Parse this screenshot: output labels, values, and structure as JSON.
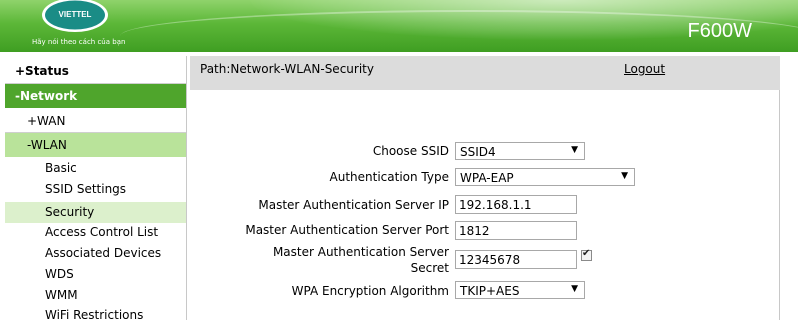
{
  "header": {
    "logo_text": "VIETTEL",
    "slogan": "Hãy nói theo cách của bạn",
    "model": "F600W",
    "brand_colors": {
      "green": "#4fa52c",
      "light_green": "#b9e39a",
      "active_sub": "#dcf0cc"
    }
  },
  "sidebar": {
    "status": "+Status",
    "network": "-Network",
    "wan": "+WAN",
    "wlan": "-WLAN",
    "wlan_items": [
      "Basic",
      "SSID Settings",
      "Security",
      "Access Control List",
      "Associated Devices",
      "WDS",
      "WMM",
      "WiFi Restrictions"
    ],
    "active_item": "Security"
  },
  "pathbar": {
    "path": "Path:Network-WLAN-Security",
    "logout": "Logout"
  },
  "form": {
    "ssid": {
      "label": "Choose SSID",
      "value": "SSID4"
    },
    "auth": {
      "label": "Authentication Type",
      "value": "WPA-EAP"
    },
    "server_ip": {
      "label": "Master Authentication Server IP",
      "value": "192.168.1.1"
    },
    "server_port": {
      "label": "Master Authentication Server Port",
      "value": "1812"
    },
    "secret": {
      "label_line1": "Master Authentication Server",
      "label_line2": "Secret",
      "value": "12345678",
      "show_checked": true
    },
    "encryption": {
      "label": "WPA Encryption Algorithm",
      "value": "TKIP+AES"
    }
  }
}
